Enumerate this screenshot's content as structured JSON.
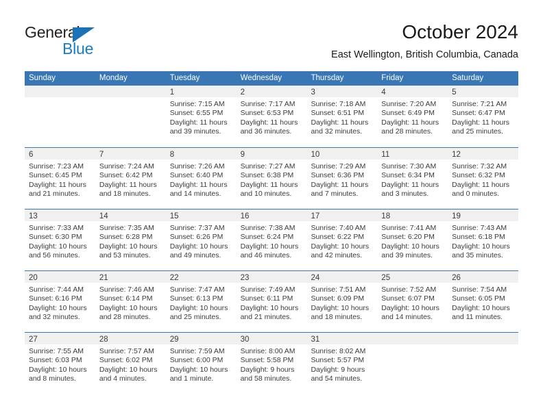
{
  "brand": {
    "name_top": "General",
    "name_bottom": "Blue",
    "triangle_icon": "triangle-icon",
    "color_dark": "#231f20",
    "color_blue": "#1b7bc4"
  },
  "header": {
    "title": "October 2024",
    "subtitle": "East Wellington, British Columbia, Canada"
  },
  "theme": {
    "header_blue": "#3876b5",
    "band_gray": "#f0f0f0",
    "text": "#3a3a3a"
  },
  "calendar": {
    "weekday_headers": [
      "Sunday",
      "Monday",
      "Tuesday",
      "Wednesday",
      "Thursday",
      "Friday",
      "Saturday"
    ],
    "labels": {
      "sunrise": "Sunrise:",
      "sunset": "Sunset:",
      "daylight": "Daylight:"
    },
    "weeks": [
      [
        {
          "day": "",
          "empty": true
        },
        {
          "day": "",
          "empty": true
        },
        {
          "day": "1",
          "sunrise": "Sunrise: 7:15 AM",
          "sunset": "Sunset: 6:55 PM",
          "daylight_1": "Daylight: 11 hours",
          "daylight_2": "and 39 minutes."
        },
        {
          "day": "2",
          "sunrise": "Sunrise: 7:17 AM",
          "sunset": "Sunset: 6:53 PM",
          "daylight_1": "Daylight: 11 hours",
          "daylight_2": "and 36 minutes."
        },
        {
          "day": "3",
          "sunrise": "Sunrise: 7:18 AM",
          "sunset": "Sunset: 6:51 PM",
          "daylight_1": "Daylight: 11 hours",
          "daylight_2": "and 32 minutes."
        },
        {
          "day": "4",
          "sunrise": "Sunrise: 7:20 AM",
          "sunset": "Sunset: 6:49 PM",
          "daylight_1": "Daylight: 11 hours",
          "daylight_2": "and 28 minutes."
        },
        {
          "day": "5",
          "sunrise": "Sunrise: 7:21 AM",
          "sunset": "Sunset: 6:47 PM",
          "daylight_1": "Daylight: 11 hours",
          "daylight_2": "and 25 minutes."
        }
      ],
      [
        {
          "day": "6",
          "sunrise": "Sunrise: 7:23 AM",
          "sunset": "Sunset: 6:45 PM",
          "daylight_1": "Daylight: 11 hours",
          "daylight_2": "and 21 minutes."
        },
        {
          "day": "7",
          "sunrise": "Sunrise: 7:24 AM",
          "sunset": "Sunset: 6:42 PM",
          "daylight_1": "Daylight: 11 hours",
          "daylight_2": "and 18 minutes."
        },
        {
          "day": "8",
          "sunrise": "Sunrise: 7:26 AM",
          "sunset": "Sunset: 6:40 PM",
          "daylight_1": "Daylight: 11 hours",
          "daylight_2": "and 14 minutes."
        },
        {
          "day": "9",
          "sunrise": "Sunrise: 7:27 AM",
          "sunset": "Sunset: 6:38 PM",
          "daylight_1": "Daylight: 11 hours",
          "daylight_2": "and 10 minutes."
        },
        {
          "day": "10",
          "sunrise": "Sunrise: 7:29 AM",
          "sunset": "Sunset: 6:36 PM",
          "daylight_1": "Daylight: 11 hours",
          "daylight_2": "and 7 minutes."
        },
        {
          "day": "11",
          "sunrise": "Sunrise: 7:30 AM",
          "sunset": "Sunset: 6:34 PM",
          "daylight_1": "Daylight: 11 hours",
          "daylight_2": "and 3 minutes."
        },
        {
          "day": "12",
          "sunrise": "Sunrise: 7:32 AM",
          "sunset": "Sunset: 6:32 PM",
          "daylight_1": "Daylight: 11 hours",
          "daylight_2": "and 0 minutes."
        }
      ],
      [
        {
          "day": "13",
          "sunrise": "Sunrise: 7:33 AM",
          "sunset": "Sunset: 6:30 PM",
          "daylight_1": "Daylight: 10 hours",
          "daylight_2": "and 56 minutes."
        },
        {
          "day": "14",
          "sunrise": "Sunrise: 7:35 AM",
          "sunset": "Sunset: 6:28 PM",
          "daylight_1": "Daylight: 10 hours",
          "daylight_2": "and 53 minutes."
        },
        {
          "day": "15",
          "sunrise": "Sunrise: 7:37 AM",
          "sunset": "Sunset: 6:26 PM",
          "daylight_1": "Daylight: 10 hours",
          "daylight_2": "and 49 minutes."
        },
        {
          "day": "16",
          "sunrise": "Sunrise: 7:38 AM",
          "sunset": "Sunset: 6:24 PM",
          "daylight_1": "Daylight: 10 hours",
          "daylight_2": "and 46 minutes."
        },
        {
          "day": "17",
          "sunrise": "Sunrise: 7:40 AM",
          "sunset": "Sunset: 6:22 PM",
          "daylight_1": "Daylight: 10 hours",
          "daylight_2": "and 42 minutes."
        },
        {
          "day": "18",
          "sunrise": "Sunrise: 7:41 AM",
          "sunset": "Sunset: 6:20 PM",
          "daylight_1": "Daylight: 10 hours",
          "daylight_2": "and 39 minutes."
        },
        {
          "day": "19",
          "sunrise": "Sunrise: 7:43 AM",
          "sunset": "Sunset: 6:18 PM",
          "daylight_1": "Daylight: 10 hours",
          "daylight_2": "and 35 minutes."
        }
      ],
      [
        {
          "day": "20",
          "sunrise": "Sunrise: 7:44 AM",
          "sunset": "Sunset: 6:16 PM",
          "daylight_1": "Daylight: 10 hours",
          "daylight_2": "and 32 minutes."
        },
        {
          "day": "21",
          "sunrise": "Sunrise: 7:46 AM",
          "sunset": "Sunset: 6:14 PM",
          "daylight_1": "Daylight: 10 hours",
          "daylight_2": "and 28 minutes."
        },
        {
          "day": "22",
          "sunrise": "Sunrise: 7:47 AM",
          "sunset": "Sunset: 6:13 PM",
          "daylight_1": "Daylight: 10 hours",
          "daylight_2": "and 25 minutes."
        },
        {
          "day": "23",
          "sunrise": "Sunrise: 7:49 AM",
          "sunset": "Sunset: 6:11 PM",
          "daylight_1": "Daylight: 10 hours",
          "daylight_2": "and 21 minutes."
        },
        {
          "day": "24",
          "sunrise": "Sunrise: 7:51 AM",
          "sunset": "Sunset: 6:09 PM",
          "daylight_1": "Daylight: 10 hours",
          "daylight_2": "and 18 minutes."
        },
        {
          "day": "25",
          "sunrise": "Sunrise: 7:52 AM",
          "sunset": "Sunset: 6:07 PM",
          "daylight_1": "Daylight: 10 hours",
          "daylight_2": "and 14 minutes."
        },
        {
          "day": "26",
          "sunrise": "Sunrise: 7:54 AM",
          "sunset": "Sunset: 6:05 PM",
          "daylight_1": "Daylight: 10 hours",
          "daylight_2": "and 11 minutes."
        }
      ],
      [
        {
          "day": "27",
          "sunrise": "Sunrise: 7:55 AM",
          "sunset": "Sunset: 6:03 PM",
          "daylight_1": "Daylight: 10 hours",
          "daylight_2": "and 8 minutes."
        },
        {
          "day": "28",
          "sunrise": "Sunrise: 7:57 AM",
          "sunset": "Sunset: 6:02 PM",
          "daylight_1": "Daylight: 10 hours",
          "daylight_2": "and 4 minutes."
        },
        {
          "day": "29",
          "sunrise": "Sunrise: 7:59 AM",
          "sunset": "Sunset: 6:00 PM",
          "daylight_1": "Daylight: 10 hours",
          "daylight_2": "and 1 minute."
        },
        {
          "day": "30",
          "sunrise": "Sunrise: 8:00 AM",
          "sunset": "Sunset: 5:58 PM",
          "daylight_1": "Daylight: 9 hours",
          "daylight_2": "and 58 minutes."
        },
        {
          "day": "31",
          "sunrise": "Sunrise: 8:02 AM",
          "sunset": "Sunset: 5:57 PM",
          "daylight_1": "Daylight: 9 hours",
          "daylight_2": "and 54 minutes."
        },
        {
          "day": "",
          "empty": true
        },
        {
          "day": "",
          "empty": true
        }
      ]
    ]
  }
}
